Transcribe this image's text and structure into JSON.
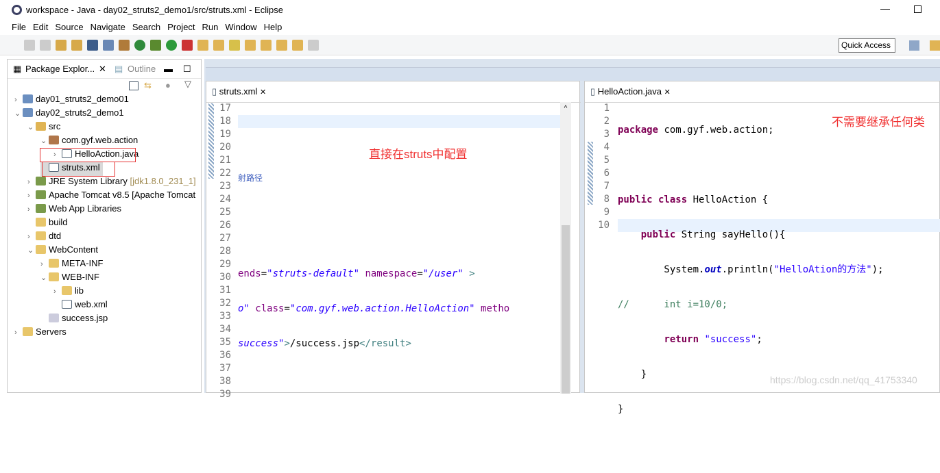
{
  "window": {
    "title": "workspace - Java - day02_struts2_demo1/src/struts.xml - Eclipse"
  },
  "menu": [
    "File",
    "Edit",
    "Source",
    "Navigate",
    "Search",
    "Project",
    "Run",
    "Window",
    "Help"
  ],
  "toolbar": {
    "quick_access": "Quick Access"
  },
  "left_panel": {
    "tabs": [
      "Package Explor...",
      "Outline"
    ],
    "tree": [
      {
        "label": "day01_struts2_demo01",
        "depth": 0,
        "expand": "collapsed",
        "icon": "project-icon"
      },
      {
        "label": "day02_struts2_demo1",
        "depth": 0,
        "expand": "expanded",
        "icon": "project-icon"
      },
      {
        "label": "src",
        "depth": 1,
        "expand": "expanded",
        "icon": "source-folder-icon"
      },
      {
        "label": "com.gyf.web.action",
        "depth": 2,
        "expand": "expanded",
        "icon": "package-icon"
      },
      {
        "label": "HelloAction.java",
        "depth": 3,
        "expand": "collapsed",
        "icon": "java-file-icon"
      },
      {
        "label": "struts.xml",
        "depth": 2,
        "expand": "none",
        "icon": "xml-file-icon",
        "selected": true
      },
      {
        "label": "JRE System Library",
        "extra": "[jdk1.8.0_231_1]",
        "depth": 1,
        "expand": "collapsed",
        "icon": "library-icon"
      },
      {
        "label": "Apache Tomcat v8.5 [Apache Tomcat",
        "depth": 1,
        "expand": "collapsed",
        "icon": "library-icon"
      },
      {
        "label": "Web App Libraries",
        "depth": 1,
        "expand": "collapsed",
        "icon": "library-icon"
      },
      {
        "label": "build",
        "depth": 1,
        "expand": "none",
        "icon": "folder-icon"
      },
      {
        "label": "dtd",
        "depth": 1,
        "expand": "collapsed",
        "icon": "folder-icon"
      },
      {
        "label": "WebContent",
        "depth": 1,
        "expand": "expanded",
        "icon": "folder-icon"
      },
      {
        "label": "META-INF",
        "depth": 2,
        "expand": "collapsed",
        "icon": "folder-icon"
      },
      {
        "label": "WEB-INF",
        "depth": 2,
        "expand": "expanded",
        "icon": "folder-icon"
      },
      {
        "label": "lib",
        "depth": 3,
        "expand": "collapsed",
        "icon": "folder-icon"
      },
      {
        "label": "web.xml",
        "depth": 3,
        "expand": "none",
        "icon": "xml-file-icon"
      },
      {
        "label": "success.jsp",
        "depth": 2,
        "expand": "none",
        "icon": "jsp-file-icon"
      },
      {
        "label": "Servers",
        "depth": 0,
        "expand": "collapsed",
        "icon": "folder-icon"
      }
    ]
  },
  "editor_left": {
    "tab": "struts.xml",
    "line_numbers": [
      "17",
      "18",
      "19",
      "20",
      "21",
      "22",
      "23",
      "24",
      "25",
      "26",
      "27",
      "28",
      "29",
      "30",
      "31",
      "32",
      "33",
      "34",
      "35",
      "36",
      "37",
      "38",
      "39"
    ],
    "annotation": "直接在struts中配置"
  },
  "editor_right": {
    "tab": "HelloAction.java",
    "line_numbers": [
      "1",
      "2",
      "3",
      "4",
      "5",
      "6",
      "7",
      "8",
      "9",
      "10"
    ],
    "annotation": "不需要继承任何类"
  },
  "watermark": "https://blog.csdn.net/qq_41753340",
  "colors": {
    "keyword": "#7f0055",
    "string": "#2a00ff",
    "annotation": "#f03030"
  }
}
